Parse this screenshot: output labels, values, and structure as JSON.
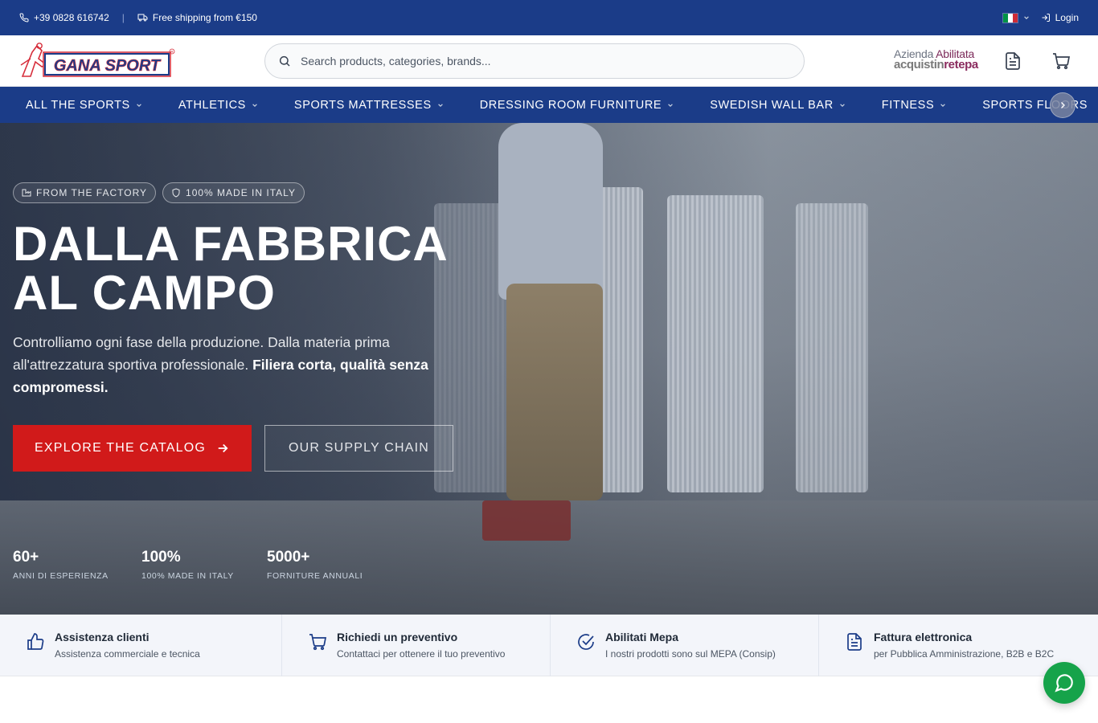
{
  "topbar": {
    "phone": "+39 0828 616742",
    "separator": "|",
    "shipping": "Free shipping from €150",
    "login": "Login",
    "language_icon": "italy-flag-icon"
  },
  "header": {
    "search_placeholder": "Search products, categories, brands...",
    "mepa_line1_a": "Azienda ",
    "mepa_line1_b": "Abilitata",
    "mepa_line2_a": "acquistin",
    "mepa_line2_b": "retepa"
  },
  "nav": {
    "items": [
      {
        "label": "ALL THE SPORTS"
      },
      {
        "label": "ATHLETICS"
      },
      {
        "label": "SPORTS MATTRESSES"
      },
      {
        "label": "DRESSING ROOM FURNITURE"
      },
      {
        "label": "SWEDISH WALL BAR"
      },
      {
        "label": "FITNESS"
      },
      {
        "label": "SPORTS FLOORS"
      }
    ]
  },
  "hero": {
    "badges": [
      "FROM THE FACTORY",
      "100% MADE IN ITALY"
    ],
    "title_line1": "DALLA FABBRICA",
    "title_line2": "AL CAMPO",
    "lead_plain": "Controlliamo ogni fase della produzione. Dalla materia prima all'attrezzatura sportiva professionale. ",
    "lead_bold": "Filiera corta, qualità senza compromessi.",
    "cta_primary": "EXPLORE THE CATALOG",
    "cta_secondary": "OUR SUPPLY CHAIN",
    "stats": [
      {
        "value": "60+",
        "label": "ANNI DI ESPERIENZA"
      },
      {
        "value": "100%",
        "label": "100% MADE IN ITALY"
      },
      {
        "value": "5000+",
        "label": "FORNITURE ANNUALI"
      }
    ]
  },
  "features": [
    {
      "title": "Assistenza clienti",
      "subtitle": "Assistenza commerciale e tecnica",
      "icon": "thumbs-up-icon"
    },
    {
      "title": "Richiedi un preventivo",
      "subtitle": "Contattaci per ottenere il tuo preventivo",
      "icon": "cart-icon"
    },
    {
      "title": "Abilitati Mepa",
      "subtitle": "I nostri prodotti sono sul MEPA (Consip)",
      "icon": "check-circle-icon"
    },
    {
      "title": "Fattura elettronica",
      "subtitle": "per Pubblica Amministrazione, B2B e B2C",
      "icon": "document-icon"
    }
  ],
  "colors": {
    "brand_blue": "#1b3c88",
    "cta_red": "#d11a1a",
    "whatsapp_green": "#16a34a"
  }
}
